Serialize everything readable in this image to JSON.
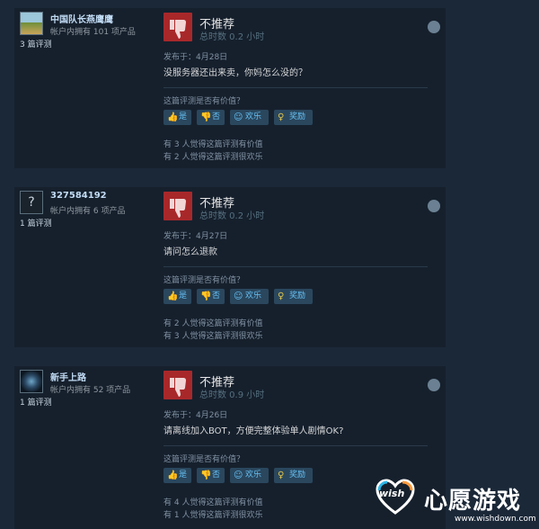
{
  "reviews": [
    {
      "username": "中国队长燕鹰鹰",
      "owned": "帐户内拥有 101 项产品",
      "review_count": "3 篇评测",
      "recommendation": "不推荐",
      "hours": "总时数 0.2 小时",
      "posted": "发布于：4月28日",
      "content": "没服务器还出来卖，你妈怎么没的？",
      "helpful_question": "这篇评测是否有价值？",
      "buttons": {
        "yes": "是",
        "no": "否",
        "funny": "欢乐",
        "award": "奖励"
      },
      "stat_helpful": "有 3 人觉得这篇评测有价值",
      "stat_funny": "有 2 人觉得这篇评测很欢乐",
      "avatar_icon": "landscape-avatar"
    },
    {
      "username": "327584192",
      "owned": "帐户内拥有 6 项产品",
      "review_count": "1 篇评测",
      "recommendation": "不推荐",
      "hours": "总时数 0.2 小时",
      "posted": "发布于：4月27日",
      "content": "请问怎么退款",
      "helpful_question": "这篇评测是否有价值？",
      "buttons": {
        "yes": "是",
        "no": "否",
        "funny": "欢乐",
        "award": "奖励"
      },
      "stat_helpful": "有 2 人觉得这篇评测有价值",
      "stat_funny": "有 3 人觉得这篇评测很欢乐",
      "avatar_text": "?"
    },
    {
      "username": "新手上路",
      "owned": "帐户内拥有 52 项产品",
      "review_count": "1 篇评测",
      "recommendation": "不推荐",
      "hours": "总时数 0.9 小时",
      "posted": "发布于：4月26日",
      "content": "请离线加入BOT，方便完整体验单人剧情OK?",
      "helpful_question": "这篇评测是否有价值？",
      "buttons": {
        "yes": "是",
        "no": "否",
        "funny": "欢乐",
        "award": "奖励"
      },
      "stat_helpful": "有 4 人觉得这篇评测有价值",
      "stat_funny": "有 1 人觉得这篇评测很欢乐",
      "avatar_icon": "blue-creature-avatar"
    }
  ],
  "watermark": {
    "title": "心愿游戏",
    "logo_word": "wish",
    "url": "www.wishdown.com"
  },
  "colors": {
    "not_recommended": "#a8282a",
    "button_bg": "#2a475e",
    "link": "#66c0f4"
  }
}
